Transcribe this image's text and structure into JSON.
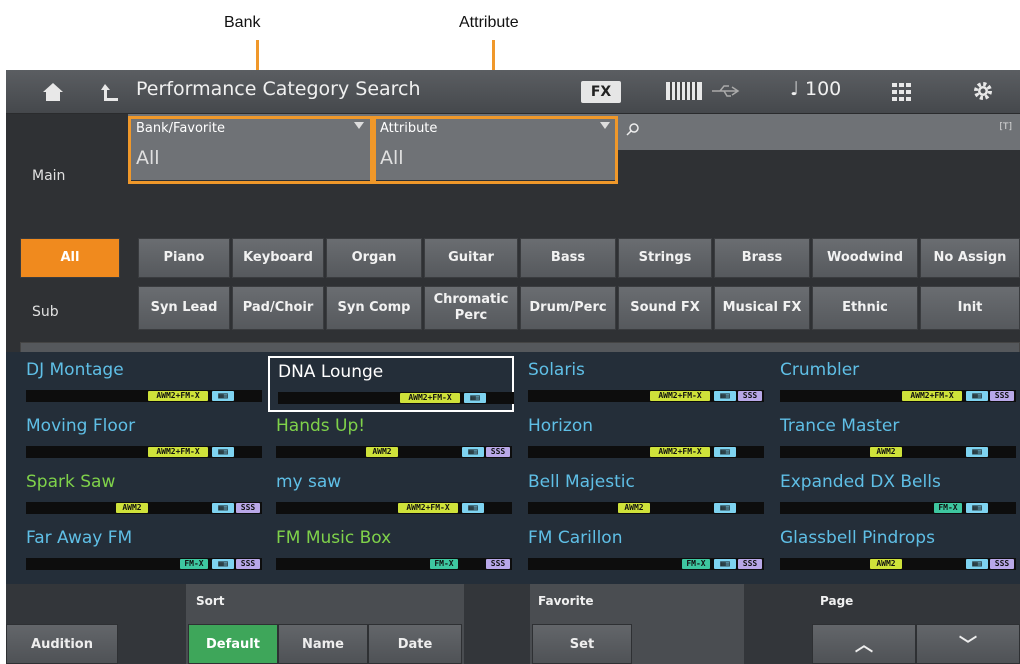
{
  "callouts": {
    "bank": "Bank",
    "attribute": "Attribute"
  },
  "topbar": {
    "title": "Performance Category Search",
    "fx": "FX",
    "tempo": "♩ 100"
  },
  "search": {
    "bank_label": "Bank/Favorite",
    "bank_value": "All",
    "attr_label": "Attribute",
    "attr_value": "All",
    "text_badge": "[T]"
  },
  "main_label": "Main",
  "sub_label": "Sub",
  "main_buttons": [
    "All",
    "Piano",
    "Keyboard",
    "Organ",
    "Guitar",
    "Bass",
    "Strings",
    "Brass",
    "Woodwind",
    "No Assign"
  ],
  "sub_buttons": [
    "Syn Lead",
    "Pad/Choir",
    "Syn Comp",
    "Chromatic\nPerc",
    "Drum/Perc",
    "Sound FX",
    "Musical FX",
    "Ethnic",
    "Init"
  ],
  "results": [
    {
      "name": "DJ Montage",
      "color": "#5fbfe6",
      "tags": [
        "awm2fmx",
        "cat"
      ]
    },
    {
      "name": "DNA Lounge",
      "color": "#ffffff",
      "selected": true,
      "tags": [
        "awm2fmx",
        "cat"
      ]
    },
    {
      "name": "Solaris",
      "color": "#5fbfe6",
      "tags": [
        "awm2fmx",
        "cat",
        "sss"
      ]
    },
    {
      "name": "Crumbler",
      "color": "#5fbfe6",
      "tags": [
        "awm2fmx",
        "cat",
        "sss"
      ]
    },
    {
      "name": "Moving Floor",
      "color": "#5fbfe6",
      "tags": [
        "awm2fmx",
        "cat"
      ]
    },
    {
      "name": "Hands Up!",
      "color": "#7fd24a",
      "tags": [
        "awm2",
        "cat",
        "sss"
      ]
    },
    {
      "name": "Horizon",
      "color": "#5fbfe6",
      "tags": [
        "awm2fmx",
        "cat"
      ]
    },
    {
      "name": "Trance Master",
      "color": "#5fbfe6",
      "tags": [
        "awm2",
        "cat"
      ]
    },
    {
      "name": "Spark Saw",
      "color": "#7fd24a",
      "tags": [
        "awm2",
        "cat",
        "sss"
      ]
    },
    {
      "name": "my saw",
      "color": "#5fbfe6",
      "tags": [
        "awm2fmx",
        "cat"
      ]
    },
    {
      "name": "Bell Majestic",
      "color": "#5fbfe6",
      "tags": [
        "awm2",
        "cat"
      ]
    },
    {
      "name": "Expanded DX Bells",
      "color": "#5fbfe6",
      "tags": [
        "fmx",
        "cat"
      ]
    },
    {
      "name": "Far Away FM",
      "color": "#5fbfe6",
      "tags": [
        "fmx",
        "cat",
        "sss"
      ]
    },
    {
      "name": "FM Music Box",
      "color": "#7fd24a",
      "tags": [
        "fmx",
        "sss"
      ]
    },
    {
      "name": "FM Carillon",
      "color": "#5fbfe6",
      "tags": [
        "fmx",
        "cat",
        "sss"
      ]
    },
    {
      "name": "Glassbell Pindrops",
      "color": "#5fbfe6",
      "tags": [
        "awm2",
        "cat",
        "sss"
      ]
    }
  ],
  "tag_text": {
    "awm2fmx": "AWM2+FM-X",
    "awm2": "AWM2",
    "fmx": "FM-X",
    "cat": "▦▤",
    "sss": "SSS"
  },
  "bottom": {
    "audition": "Audition",
    "sort_label": "Sort",
    "sort_default": "Default",
    "sort_name": "Name",
    "sort_date": "Date",
    "fav_label": "Favorite",
    "fav_set": "Set",
    "page_label": "Page",
    "page_up": "︿",
    "page_down": "﹀"
  }
}
